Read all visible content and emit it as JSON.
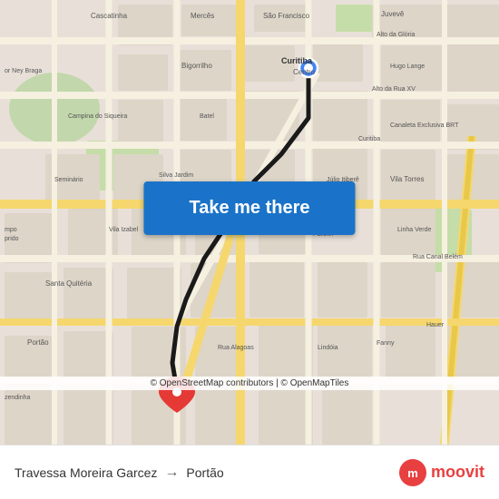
{
  "map": {
    "attribution": "© OpenStreetMap contributors | © OpenMapTiles"
  },
  "button": {
    "label": "Take me there"
  },
  "footer": {
    "origin": "Travessa Moreira Garcez",
    "arrow": "→",
    "destination": "Portão",
    "logo_text": "moovit"
  }
}
